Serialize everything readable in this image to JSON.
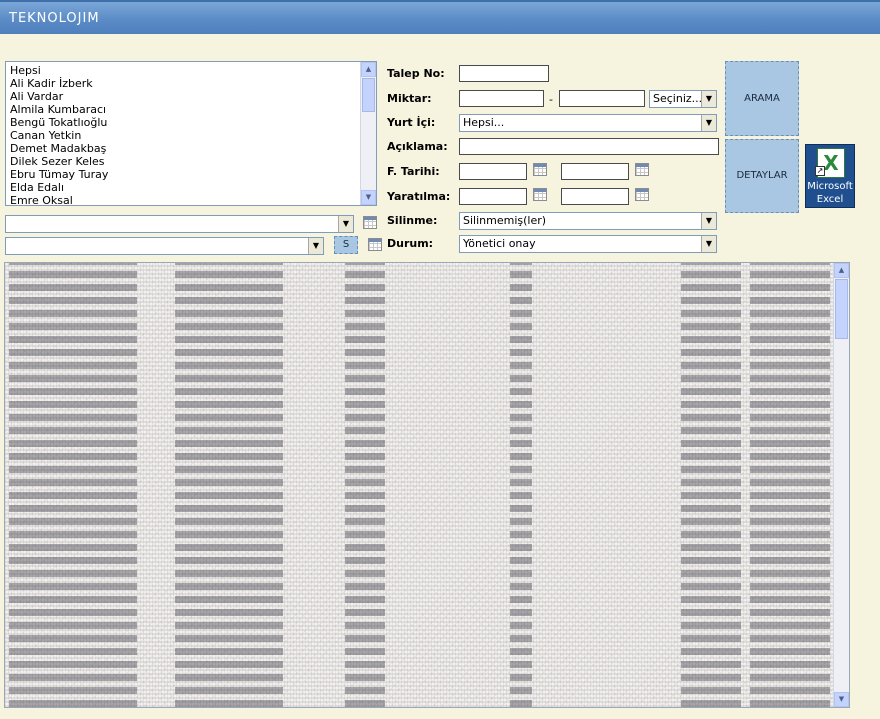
{
  "app": {
    "title": "TEKNOLOJIM"
  },
  "users": {
    "items": [
      "Hepsi",
      "Ali Kadir İzberk",
      "Ali Vardar",
      "Almila Kumbaracı",
      "Bengü Tokatlıoğlu",
      "Canan Yetkin",
      "Demet Madakbaş",
      "Dilek Sezer Keles",
      "Ebru Tümay Turay",
      "Elda Edalı",
      "Emre Oksal"
    ]
  },
  "left_filters": {
    "select1_value": "",
    "select2_value": "",
    "s_button_label": "S"
  },
  "form": {
    "talep_no_label": "Talep No:",
    "talep_no_value": "",
    "miktar_label": "Miktar:",
    "miktar_from": "",
    "miktar_separator": "-",
    "miktar_to": "",
    "miktar_unit_value": "Seçiniz...",
    "yurt_ici_label": "Yurt İçi:",
    "yurt_ici_value": "Hepsi...",
    "aciklama_label": "Açıklama:",
    "aciklama_value": "",
    "f_tarihi_label": "F. Tarihi:",
    "f_tarihi_from": "",
    "f_tarihi_to": "",
    "yaratilma_label": "Yaratılma:",
    "yaratilma_from": "",
    "yaratilma_to": "",
    "silinme_label": "Silinme:",
    "silinme_value": "Silinmemiş(ler)",
    "durum_label": "Durum:",
    "durum_value": "Yönetici onay"
  },
  "actions": {
    "arama_label": "ARAMA",
    "detaylar_label": "DETAYLAR",
    "excel_line1": "Microsoft",
    "excel_line2": "Excel"
  },
  "icons": {
    "calendar": "calendar-icon",
    "dropdown": "chevron-down-icon",
    "excel": "excel-icon"
  },
  "colors": {
    "page_bg": "#f6f3df",
    "titlebar": "#5b8cc6",
    "button_bg": "#a9c6e3",
    "excel_bg": "#1f4f8f"
  }
}
